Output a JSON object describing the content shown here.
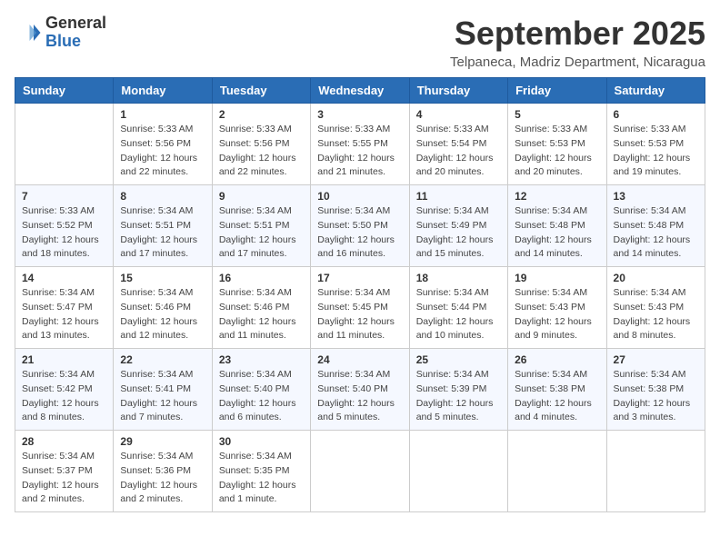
{
  "logo": {
    "general": "General",
    "blue": "Blue"
  },
  "title": "September 2025",
  "location": "Telpaneca, Madriz Department, Nicaragua",
  "days_of_week": [
    "Sunday",
    "Monday",
    "Tuesday",
    "Wednesday",
    "Thursday",
    "Friday",
    "Saturday"
  ],
  "weeks": [
    [
      {
        "day": "",
        "info": ""
      },
      {
        "day": "1",
        "info": "Sunrise: 5:33 AM\nSunset: 5:56 PM\nDaylight: 12 hours\nand 22 minutes."
      },
      {
        "day": "2",
        "info": "Sunrise: 5:33 AM\nSunset: 5:56 PM\nDaylight: 12 hours\nand 22 minutes."
      },
      {
        "day": "3",
        "info": "Sunrise: 5:33 AM\nSunset: 5:55 PM\nDaylight: 12 hours\nand 21 minutes."
      },
      {
        "day": "4",
        "info": "Sunrise: 5:33 AM\nSunset: 5:54 PM\nDaylight: 12 hours\nand 20 minutes."
      },
      {
        "day": "5",
        "info": "Sunrise: 5:33 AM\nSunset: 5:53 PM\nDaylight: 12 hours\nand 20 minutes."
      },
      {
        "day": "6",
        "info": "Sunrise: 5:33 AM\nSunset: 5:53 PM\nDaylight: 12 hours\nand 19 minutes."
      }
    ],
    [
      {
        "day": "7",
        "info": "Sunrise: 5:33 AM\nSunset: 5:52 PM\nDaylight: 12 hours\nand 18 minutes."
      },
      {
        "day": "8",
        "info": "Sunrise: 5:34 AM\nSunset: 5:51 PM\nDaylight: 12 hours\nand 17 minutes."
      },
      {
        "day": "9",
        "info": "Sunrise: 5:34 AM\nSunset: 5:51 PM\nDaylight: 12 hours\nand 17 minutes."
      },
      {
        "day": "10",
        "info": "Sunrise: 5:34 AM\nSunset: 5:50 PM\nDaylight: 12 hours\nand 16 minutes."
      },
      {
        "day": "11",
        "info": "Sunrise: 5:34 AM\nSunset: 5:49 PM\nDaylight: 12 hours\nand 15 minutes."
      },
      {
        "day": "12",
        "info": "Sunrise: 5:34 AM\nSunset: 5:48 PM\nDaylight: 12 hours\nand 14 minutes."
      },
      {
        "day": "13",
        "info": "Sunrise: 5:34 AM\nSunset: 5:48 PM\nDaylight: 12 hours\nand 14 minutes."
      }
    ],
    [
      {
        "day": "14",
        "info": "Sunrise: 5:34 AM\nSunset: 5:47 PM\nDaylight: 12 hours\nand 13 minutes."
      },
      {
        "day": "15",
        "info": "Sunrise: 5:34 AM\nSunset: 5:46 PM\nDaylight: 12 hours\nand 12 minutes."
      },
      {
        "day": "16",
        "info": "Sunrise: 5:34 AM\nSunset: 5:46 PM\nDaylight: 12 hours\nand 11 minutes."
      },
      {
        "day": "17",
        "info": "Sunrise: 5:34 AM\nSunset: 5:45 PM\nDaylight: 12 hours\nand 11 minutes."
      },
      {
        "day": "18",
        "info": "Sunrise: 5:34 AM\nSunset: 5:44 PM\nDaylight: 12 hours\nand 10 minutes."
      },
      {
        "day": "19",
        "info": "Sunrise: 5:34 AM\nSunset: 5:43 PM\nDaylight: 12 hours\nand 9 minutes."
      },
      {
        "day": "20",
        "info": "Sunrise: 5:34 AM\nSunset: 5:43 PM\nDaylight: 12 hours\nand 8 minutes."
      }
    ],
    [
      {
        "day": "21",
        "info": "Sunrise: 5:34 AM\nSunset: 5:42 PM\nDaylight: 12 hours\nand 8 minutes."
      },
      {
        "day": "22",
        "info": "Sunrise: 5:34 AM\nSunset: 5:41 PM\nDaylight: 12 hours\nand 7 minutes."
      },
      {
        "day": "23",
        "info": "Sunrise: 5:34 AM\nSunset: 5:40 PM\nDaylight: 12 hours\nand 6 minutes."
      },
      {
        "day": "24",
        "info": "Sunrise: 5:34 AM\nSunset: 5:40 PM\nDaylight: 12 hours\nand 5 minutes."
      },
      {
        "day": "25",
        "info": "Sunrise: 5:34 AM\nSunset: 5:39 PM\nDaylight: 12 hours\nand 5 minutes."
      },
      {
        "day": "26",
        "info": "Sunrise: 5:34 AM\nSunset: 5:38 PM\nDaylight: 12 hours\nand 4 minutes."
      },
      {
        "day": "27",
        "info": "Sunrise: 5:34 AM\nSunset: 5:38 PM\nDaylight: 12 hours\nand 3 minutes."
      }
    ],
    [
      {
        "day": "28",
        "info": "Sunrise: 5:34 AM\nSunset: 5:37 PM\nDaylight: 12 hours\nand 2 minutes."
      },
      {
        "day": "29",
        "info": "Sunrise: 5:34 AM\nSunset: 5:36 PM\nDaylight: 12 hours\nand 2 minutes."
      },
      {
        "day": "30",
        "info": "Sunrise: 5:34 AM\nSunset: 5:35 PM\nDaylight: 12 hours\nand 1 minute."
      },
      {
        "day": "",
        "info": ""
      },
      {
        "day": "",
        "info": ""
      },
      {
        "day": "",
        "info": ""
      },
      {
        "day": "",
        "info": ""
      }
    ]
  ]
}
